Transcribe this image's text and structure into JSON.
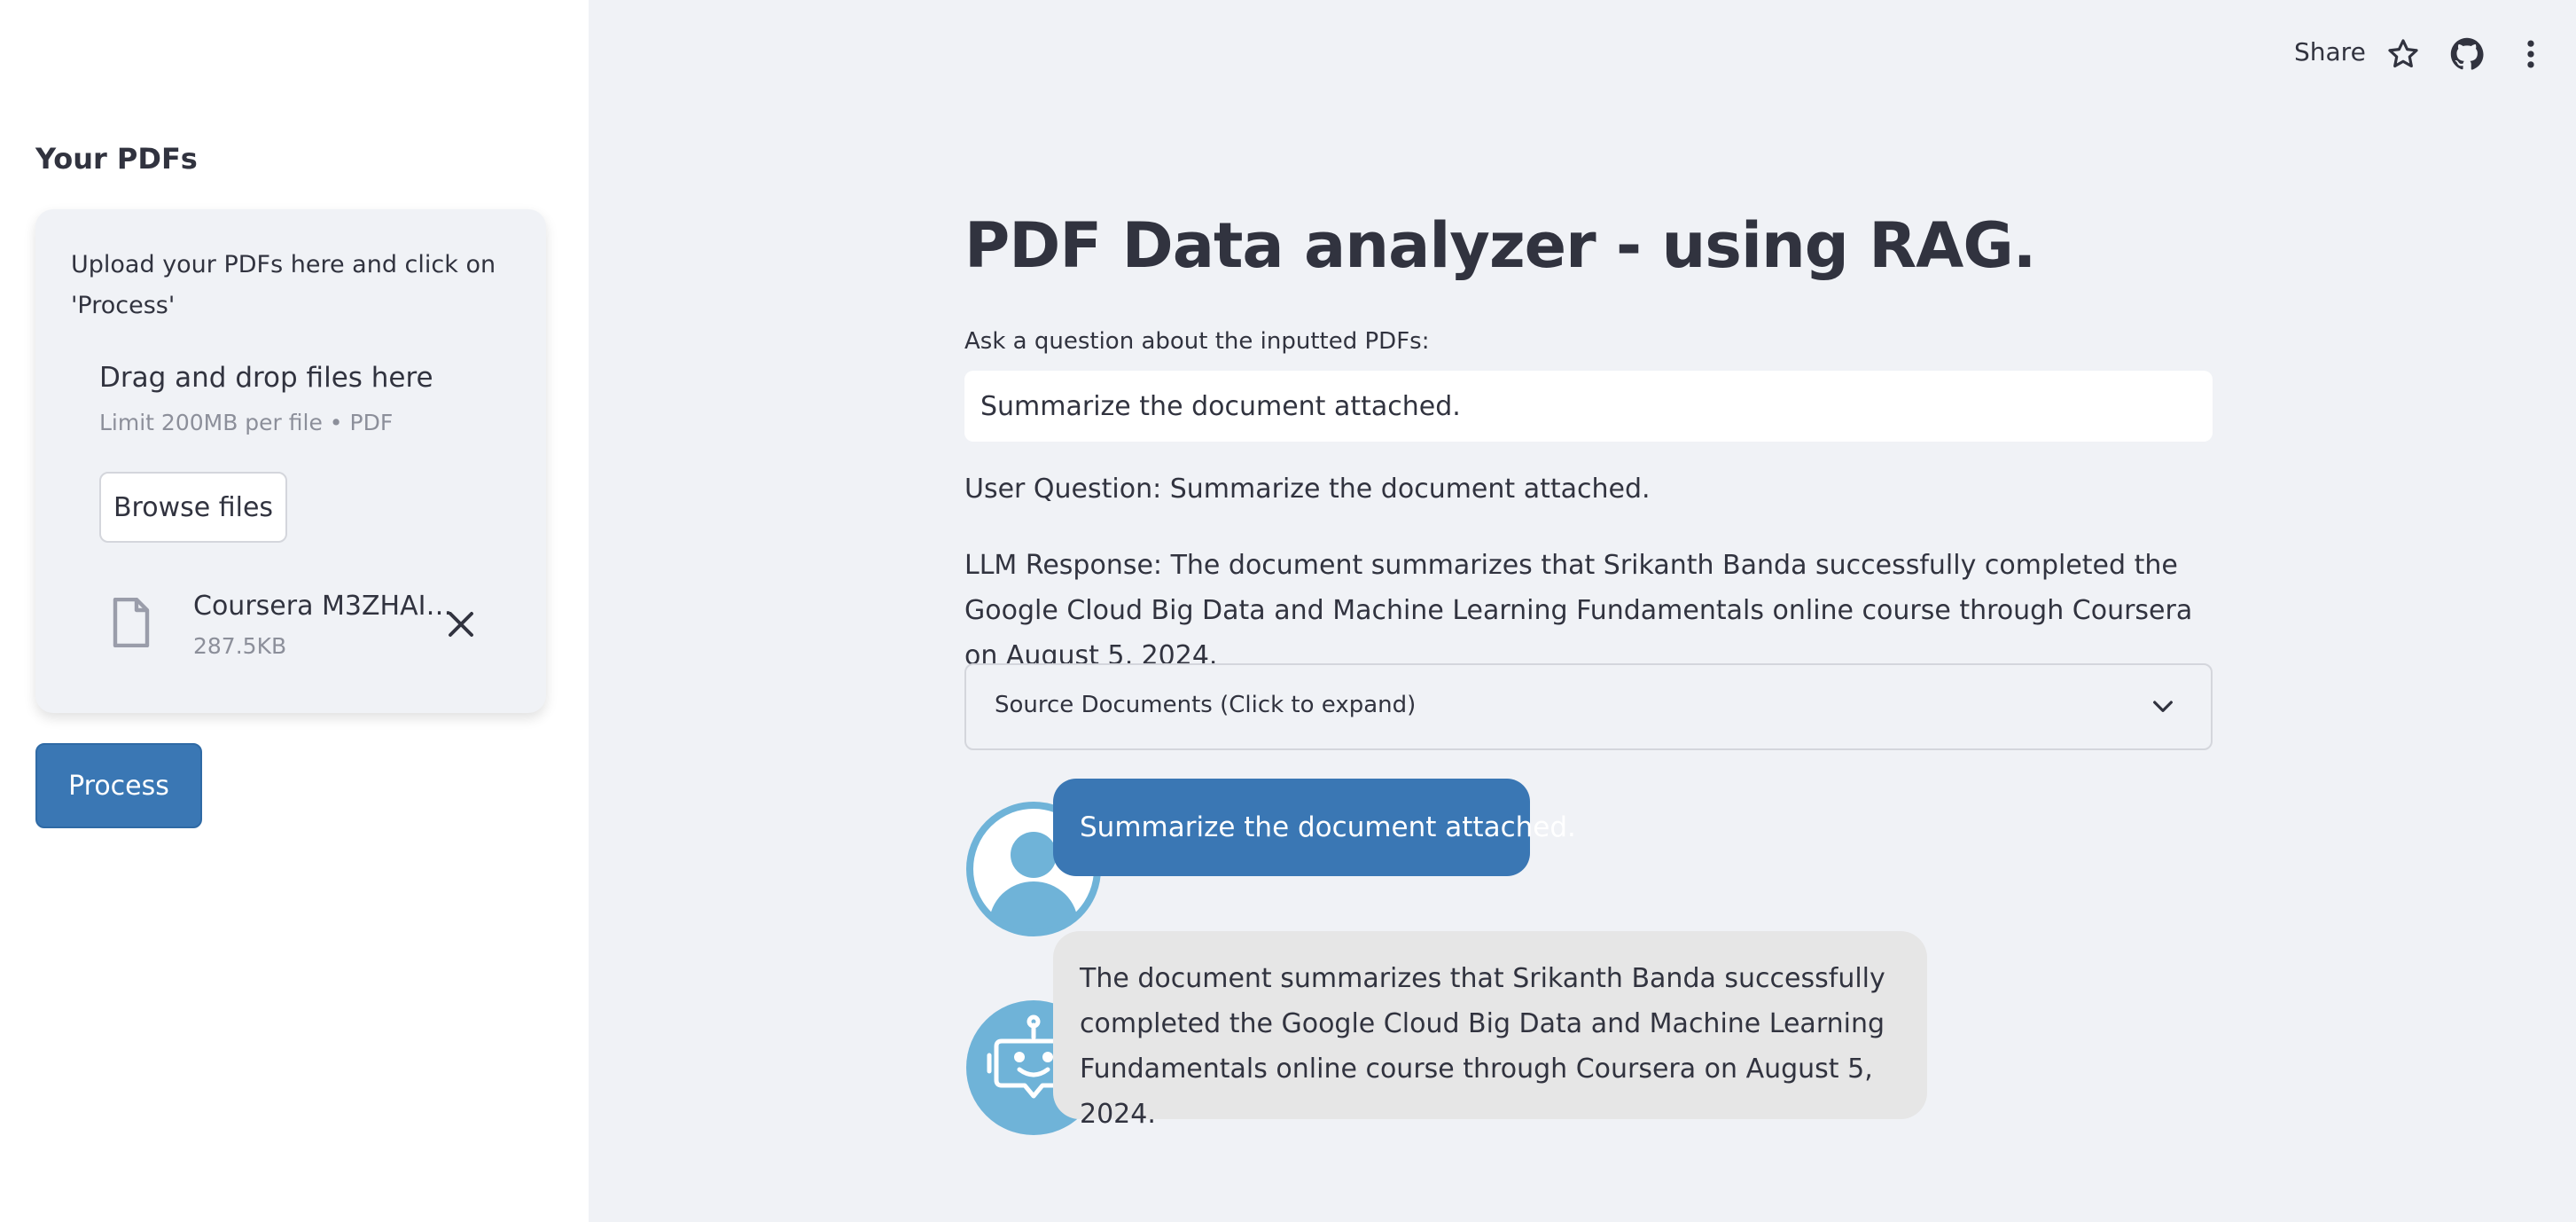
{
  "sidebar": {
    "title": "Your PDFs",
    "upload_hint": "Upload your PDFs here and click on 'Process'",
    "dropzone_title": "Drag and drop files here",
    "dropzone_limit": "Limit 200MB per file • PDF",
    "browse_label": "Browse files",
    "file": {
      "name": "Coursera M3ZHAIS…",
      "size": "287.5KB"
    },
    "process_label": "Process"
  },
  "header": {
    "share_label": "Share",
    "icons": [
      "star-icon",
      "github-icon",
      "more-vertical-icon"
    ]
  },
  "main": {
    "title": "PDF Data analyzer - using RAG.",
    "question_label": "Ask a question about the inputted PDFs:",
    "question_value": "Summarize the document attached.",
    "user_question": "User Question: Summarize the document attached.",
    "llm_response": "LLM Response: The document summarizes that Srikanth Banda successfully completed the Google Cloud Big Data and Machine Learning Fundamentals online course through Coursera on August 5, 2024.",
    "expander_label": "Source Documents (Click to expand)"
  },
  "chat": {
    "messages": [
      {
        "role": "user",
        "text": "Summarize the document attached."
      },
      {
        "role": "bot",
        "text": "The document summarizes that Srikanth Banda successfully completed the Google Cloud Big Data and Machine Learning Fundamentals online course through Coursera on August 5, 2024."
      }
    ]
  },
  "colors": {
    "accent": "#3a77b4",
    "avatar": "#6fb3d8",
    "background": "#f0f2f6",
    "sidebar": "#ffffff",
    "bot_bubble": "#e6e6e6"
  }
}
